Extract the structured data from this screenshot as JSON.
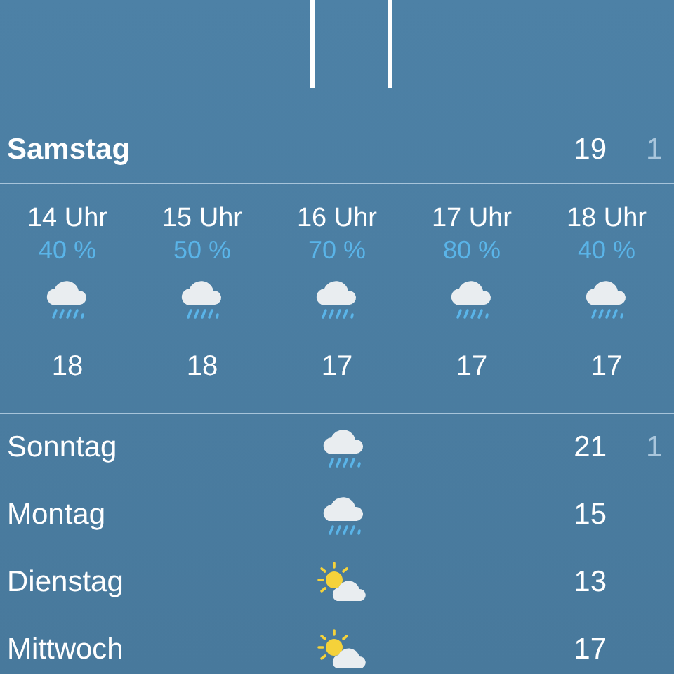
{
  "today": {
    "day": "Samstag",
    "high": "19",
    "low": "1"
  },
  "hourly": [
    {
      "time": "14 Uhr",
      "chance": "40 %",
      "kind": "rain",
      "temp": "18"
    },
    {
      "time": "15 Uhr",
      "chance": "50 %",
      "kind": "rain",
      "temp": "18"
    },
    {
      "time": "16 Uhr",
      "chance": "70 %",
      "kind": "rain",
      "temp": "17"
    },
    {
      "time": "17 Uhr",
      "chance": "80 %",
      "kind": "rain",
      "temp": "17"
    },
    {
      "time": "18 Uhr",
      "chance": "40 %",
      "kind": "rain",
      "temp": "17"
    }
  ],
  "daily": [
    {
      "day": "Sonntag",
      "kind": "rain",
      "high": "21",
      "low": "1"
    },
    {
      "day": "Montag",
      "kind": "rain",
      "high": "15"
    },
    {
      "day": "Dienstag",
      "kind": "partly_sunny",
      "high": "13"
    },
    {
      "day": "Mittwoch",
      "kind": "partly_sunny",
      "high": "17"
    }
  ]
}
